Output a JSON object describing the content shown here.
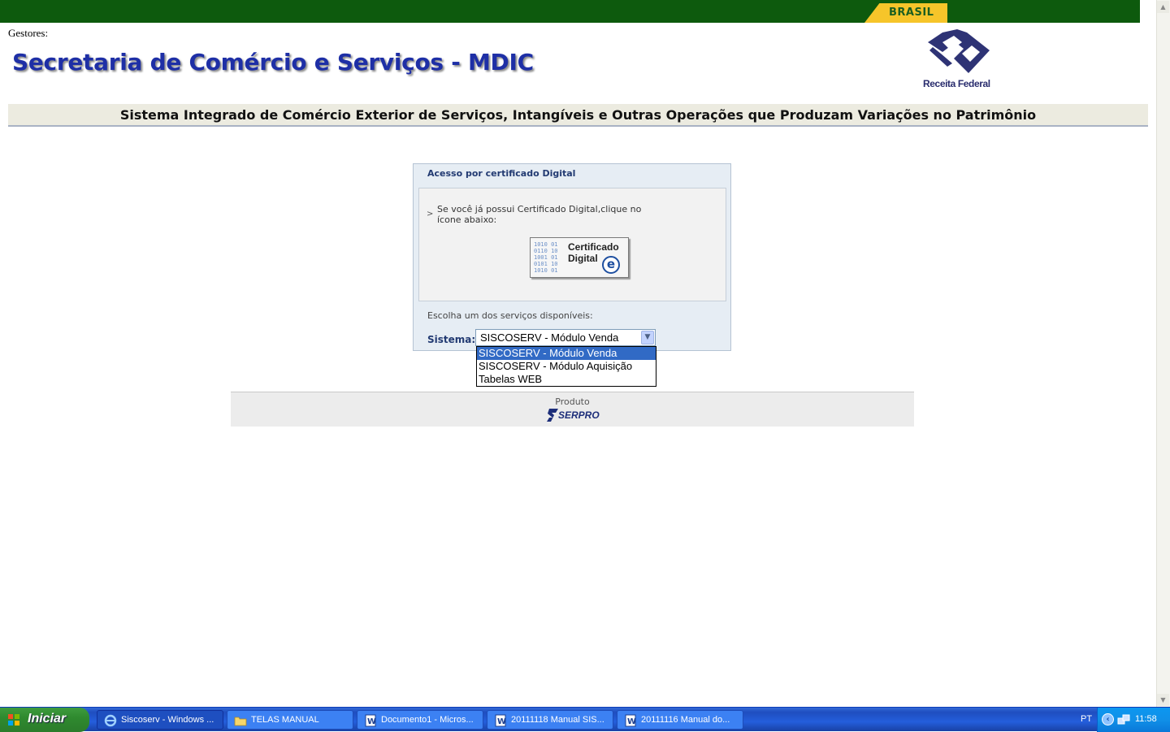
{
  "banner": {
    "brasil_label": "BRASIL"
  },
  "header": {
    "gestores_label": "Gestores:",
    "title": "Secretaria de Comércio e Serviços - MDIC",
    "logo_label": "Receita Federal"
  },
  "system_title": "Sistema Integrado de Comércio Exterior de Serviços, Intangíveis e Outras Operações que Produzam Variações no Patrimônio",
  "access_panel": {
    "heading": "Acesso por certificado Digital",
    "arrow": ">",
    "instruction": "Se você já possui Certificado Digital,clique no ícone abaixo:",
    "cert_button": {
      "line1": "Certificado",
      "line2": "Digital",
      "icon": "e-certificate-icon"
    },
    "services_label": "Escolha um dos serviços disponíveis:",
    "sistema_label": "Sistema:",
    "select_value": "SISCOSERV - Módulo Venda",
    "options": [
      "SISCOSERV - Módulo Venda",
      "SISCOSERV - Módulo Aquisição",
      "Tabelas WEB"
    ],
    "selected_index": 0
  },
  "footer": {
    "produto_label": "Produto",
    "brand": "SERPRO"
  },
  "taskbar": {
    "start_label": "Iniciar",
    "tasks": [
      {
        "label": "Siscoserv - Windows ...",
        "icon": "internet-explorer-icon",
        "active": true
      },
      {
        "label": "TELAS MANUAL",
        "icon": "folder-icon",
        "active": false
      },
      {
        "label": "Documento1 - Micros...",
        "icon": "word-document-icon",
        "active": false
      },
      {
        "label": "20111118 Manual SIS...",
        "icon": "word-document-icon",
        "active": false
      },
      {
        "label": "20111116  Manual do...",
        "icon": "word-document-icon",
        "active": false
      }
    ],
    "language": "PT",
    "clock": "11:58"
  },
  "colors": {
    "banner_green": "#0d5a0d",
    "title_blue": "#1e2fa6",
    "selection_blue": "#316ac5",
    "taskbar_blue": "#245edc",
    "start_green": "#2f8a2f"
  }
}
